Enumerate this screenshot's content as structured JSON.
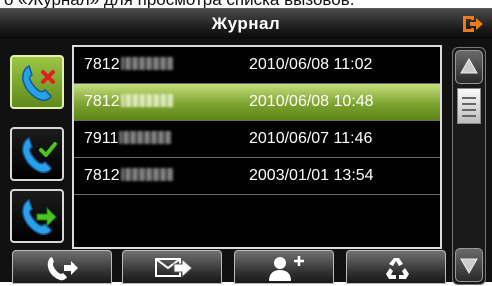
{
  "caption": {
    "text": "о «Журнал» для просмотра списка вызовов."
  },
  "header": {
    "title": "Журнал"
  },
  "sidebar": {
    "items": [
      {
        "name": "missed-calls",
        "icon": "phone-missed-icon"
      },
      {
        "name": "received-calls",
        "icon": "phone-received-icon"
      },
      {
        "name": "dialed-calls",
        "icon": "phone-outgoing-icon"
      }
    ]
  },
  "calls": [
    {
      "number": "7812",
      "datetime": "2010/06/08 11:02"
    },
    {
      "number": "7812",
      "datetime": "2010/06/08 10:48"
    },
    {
      "number": "7911",
      "datetime": "2010/06/07 11:46"
    },
    {
      "number": "7812",
      "datetime": "2003/01/01 13:54"
    }
  ],
  "selected_index": 1,
  "toolbar": {
    "buttons": [
      {
        "name": "call",
        "icon": "phone-call-icon"
      },
      {
        "name": "sms",
        "icon": "envelope-send-icon"
      },
      {
        "name": "add-contact",
        "icon": "add-contact-icon"
      },
      {
        "name": "delete",
        "icon": "recycle-icon"
      }
    ]
  },
  "colors": {
    "selected_green": "#7ea430",
    "exit_orange": "#f07a14",
    "phone_blue": "#2aa0e6"
  }
}
